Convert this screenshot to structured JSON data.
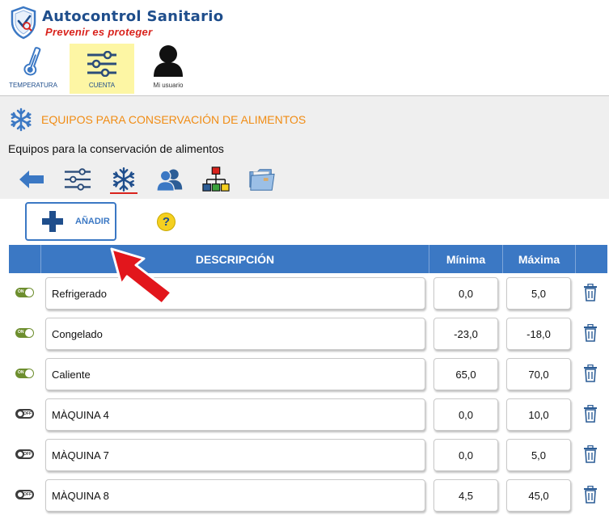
{
  "brand": {
    "title": "Autocontrol Sanitario",
    "subtitle": "Prevenir es proteger"
  },
  "topnav": [
    {
      "label": "TEMPERATURA",
      "icon": "thermometer-icon"
    },
    {
      "label": "CUENTA",
      "icon": "sliders-icon",
      "active": true
    },
    {
      "label": "Mi usuario",
      "icon": "user-icon"
    }
  ],
  "section": {
    "title": "EQUIPOS PARA CONSERVACIÓN DE ALIMENTOS",
    "subtitle": "Equipos para la conservación de alimentos"
  },
  "toolbar": [
    {
      "icon": "back-arrow-icon"
    },
    {
      "icon": "sliders-icon"
    },
    {
      "icon": "snowflake-icon",
      "active": true
    },
    {
      "icon": "users-icon"
    },
    {
      "icon": "org-chart-icon"
    },
    {
      "icon": "folder-icon"
    }
  ],
  "actions": {
    "add_label": "AÑADIR",
    "help_label": "?"
  },
  "table": {
    "headers": {
      "description": "DESCRIPCIÓN",
      "min": "Mínima",
      "max": "Máxima"
    },
    "rows": [
      {
        "enabled": true,
        "toggle_text": "ON",
        "description": "Refrigerado",
        "min": "0,0",
        "max": "5,0"
      },
      {
        "enabled": true,
        "toggle_text": "ON",
        "description": "Congelado",
        "min": "-23,0",
        "max": "-18,0"
      },
      {
        "enabled": true,
        "toggle_text": "ON",
        "description": "Caliente",
        "min": "65,0",
        "max": "70,0"
      },
      {
        "enabled": false,
        "toggle_text": "OFF",
        "description": "MÀQUINA 4",
        "min": "0,0",
        "max": "10,0"
      },
      {
        "enabled": false,
        "toggle_text": "OFF",
        "description": "MÀQUINA 7",
        "min": "0,0",
        "max": "5,0"
      },
      {
        "enabled": false,
        "toggle_text": "OFF",
        "description": "MÀQUINA 8",
        "min": "4,5",
        "max": "45,0"
      }
    ]
  },
  "colors": {
    "primary": "#3b78c4",
    "accent_orange": "#f08c14",
    "brand_red": "#d9231d",
    "toggle_on": "#6d8e2e",
    "nav_active_bg": "#fdf6a4"
  }
}
